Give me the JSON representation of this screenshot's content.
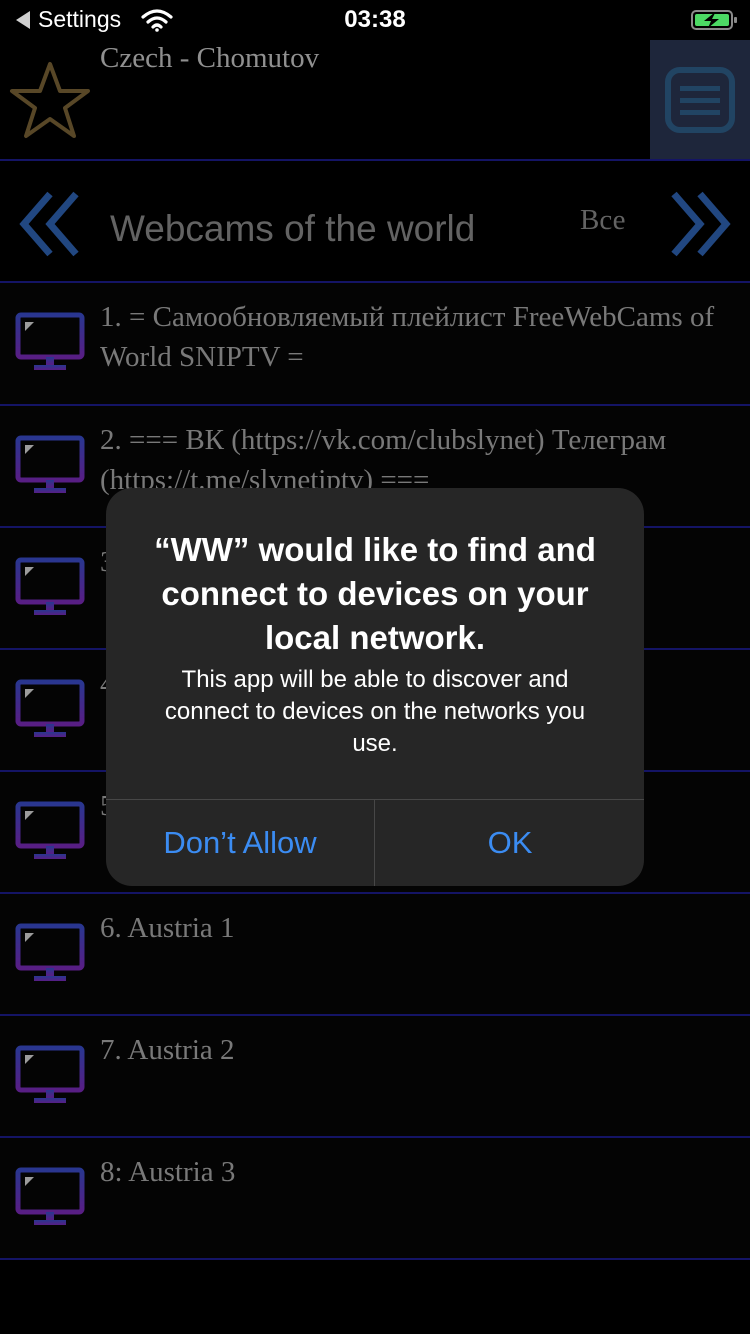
{
  "status_bar": {
    "back_app": "Settings",
    "time": "03:38",
    "icons": [
      "back-arrow-icon",
      "wifi-icon",
      "battery-charging-icon"
    ]
  },
  "header": {
    "location": "Czech - Chomutov",
    "icons": [
      "star-icon",
      "menu-icon"
    ]
  },
  "nav": {
    "title": "Webcams of the world",
    "filter": "Все",
    "icons": [
      "chevron-double-left-icon",
      "chevron-double-right-icon"
    ]
  },
  "list": {
    "items": [
      {
        "label": "1. = Самообновляемый плейлист FreeWebCams of World SNIPTV ="
      },
      {
        "label": "2. === ВК (https://vk.com/clubslynet) Телеграм (https://t.me/slynetiptv) ==="
      },
      {
        "label": "3"
      },
      {
        "label": "4"
      },
      {
        "label": "5"
      },
      {
        "label": "6. Austria 1"
      },
      {
        "label": "7. Austria 2"
      },
      {
        "label": "8: Austria 3"
      }
    ],
    "item_icon": "tv-monitor-icon"
  },
  "alert": {
    "title": "“WW” would like to find and connect to devices on your local network.",
    "message": "This app will be able to discover and connect to devices on the networks you use.",
    "cancel_label": "Don’t Allow",
    "ok_label": "OK"
  },
  "colors": {
    "accent_blue": "#3b8cf2",
    "divider": "#1d1d8c",
    "menu_bg": "#2a3552",
    "chevron": "#2f63b3",
    "star": "#7a6336"
  }
}
